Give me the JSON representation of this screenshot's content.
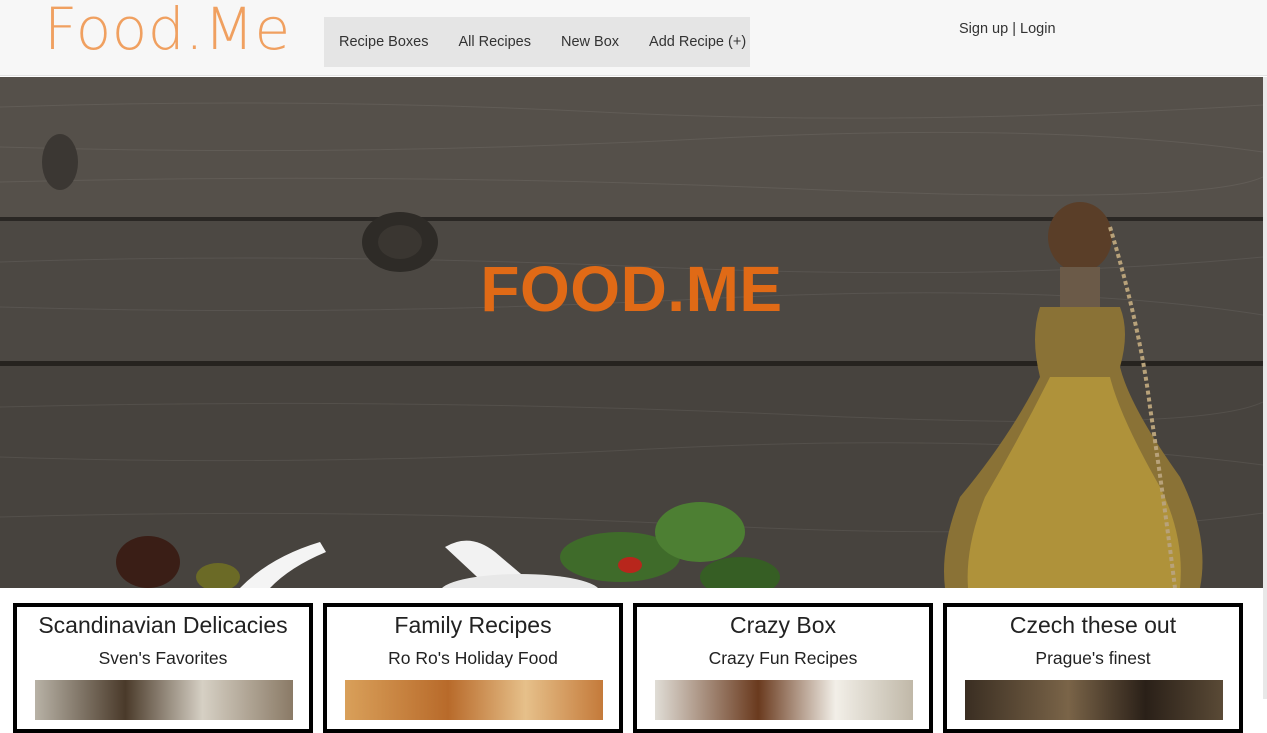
{
  "brand": {
    "logo": "Food.Me"
  },
  "nav": {
    "items": [
      "Recipe Boxes",
      "All Recipes",
      "New Box",
      "Add Recipe (+)"
    ]
  },
  "auth": {
    "signup": "Sign up",
    "separator": "|",
    "login": "Login"
  },
  "hero": {
    "title": "FOOD.ME"
  },
  "boxes": [
    {
      "title": "Scandinavian Delicacies",
      "subtitle": "Sven's Favorites"
    },
    {
      "title": "Family Recipes",
      "subtitle": "Ro Ro's Holiday Food"
    },
    {
      "title": "Crazy Box",
      "subtitle": "Crazy Fun Recipes"
    },
    {
      "title": "Czech these out",
      "subtitle": "Prague's finest"
    }
  ],
  "colors": {
    "logo": "#f0a060",
    "hero_title": "#e06a16",
    "nav_bg": "#e5e5e5",
    "card_border": "#000000"
  }
}
